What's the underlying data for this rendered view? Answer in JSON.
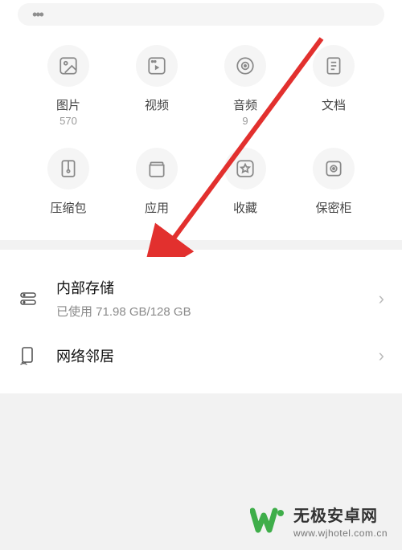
{
  "categories": [
    {
      "key": "images",
      "label": "图片",
      "count": "570"
    },
    {
      "key": "videos",
      "label": "视频",
      "count": ""
    },
    {
      "key": "audio",
      "label": "音频",
      "count": "9"
    },
    {
      "key": "docs",
      "label": "文档",
      "count": ""
    },
    {
      "key": "archives",
      "label": "压缩包",
      "count": ""
    },
    {
      "key": "apps",
      "label": "应用",
      "count": ""
    },
    {
      "key": "favorites",
      "label": "收藏",
      "count": ""
    },
    {
      "key": "safe",
      "label": "保密柜",
      "count": ""
    }
  ],
  "storage": {
    "title": "内部存储",
    "subtitle": "已使用 71.98 GB/128 GB"
  },
  "network": {
    "title": "网络邻居"
  },
  "watermark": {
    "cn": "无极安卓网",
    "en": "www.wjhotel.com.cn"
  }
}
